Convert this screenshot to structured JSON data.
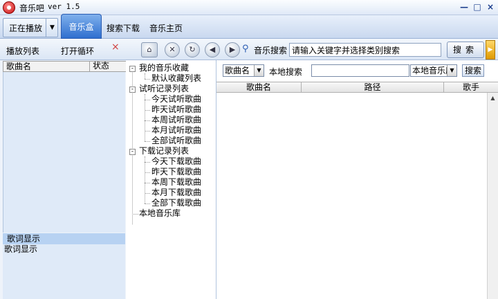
{
  "window": {
    "title": "音乐吧",
    "version": "ver 1.5",
    "minimize_glyph": "—",
    "maximize_glyph": "□",
    "close_glyph": "×"
  },
  "menu": {
    "now_playing": "正在播放",
    "tabs": [
      "音乐盒",
      "搜索下载",
      "音乐主页"
    ],
    "active_tab": "音乐盒"
  },
  "left_panel": {
    "playlist_label": "播放列表",
    "loop_label": "打开循环",
    "close_glyph": "×",
    "columns": [
      "歌曲名",
      "状态"
    ],
    "lyric_header": "歌词显示",
    "lyric_text": "歌词显示"
  },
  "toolbar": {
    "icons": [
      "home-icon",
      "stop-icon",
      "refresh-icon",
      "back-icon",
      "forward-icon",
      "search-icon"
    ],
    "music_search_label": "音乐搜索",
    "search_value": "请输入关键字并选择类别搜索",
    "search_button": "搜索"
  },
  "tree": {
    "favorites": "我的音乐收藏",
    "favorites_children": [
      "默认收藏列表"
    ],
    "trial": "试听记录列表",
    "trial_children": [
      "今天试听歌曲",
      "昨天试听歌曲",
      "本周试听歌曲",
      "本月试听歌曲",
      "全部试听歌曲"
    ],
    "download": "下载记录列表",
    "download_children": [
      "今天下载歌曲",
      "昨天下载歌曲",
      "本周下载歌曲",
      "本月下载歌曲",
      "全部下载歌曲"
    ],
    "local": "本地音乐库"
  },
  "results": {
    "field_select": "歌曲名",
    "local_search_label": "本地搜索",
    "local_search_value": "",
    "scope_select": "本地音乐库",
    "search_button": "搜索",
    "columns": [
      "歌曲名",
      "路径",
      "歌手"
    ]
  }
}
